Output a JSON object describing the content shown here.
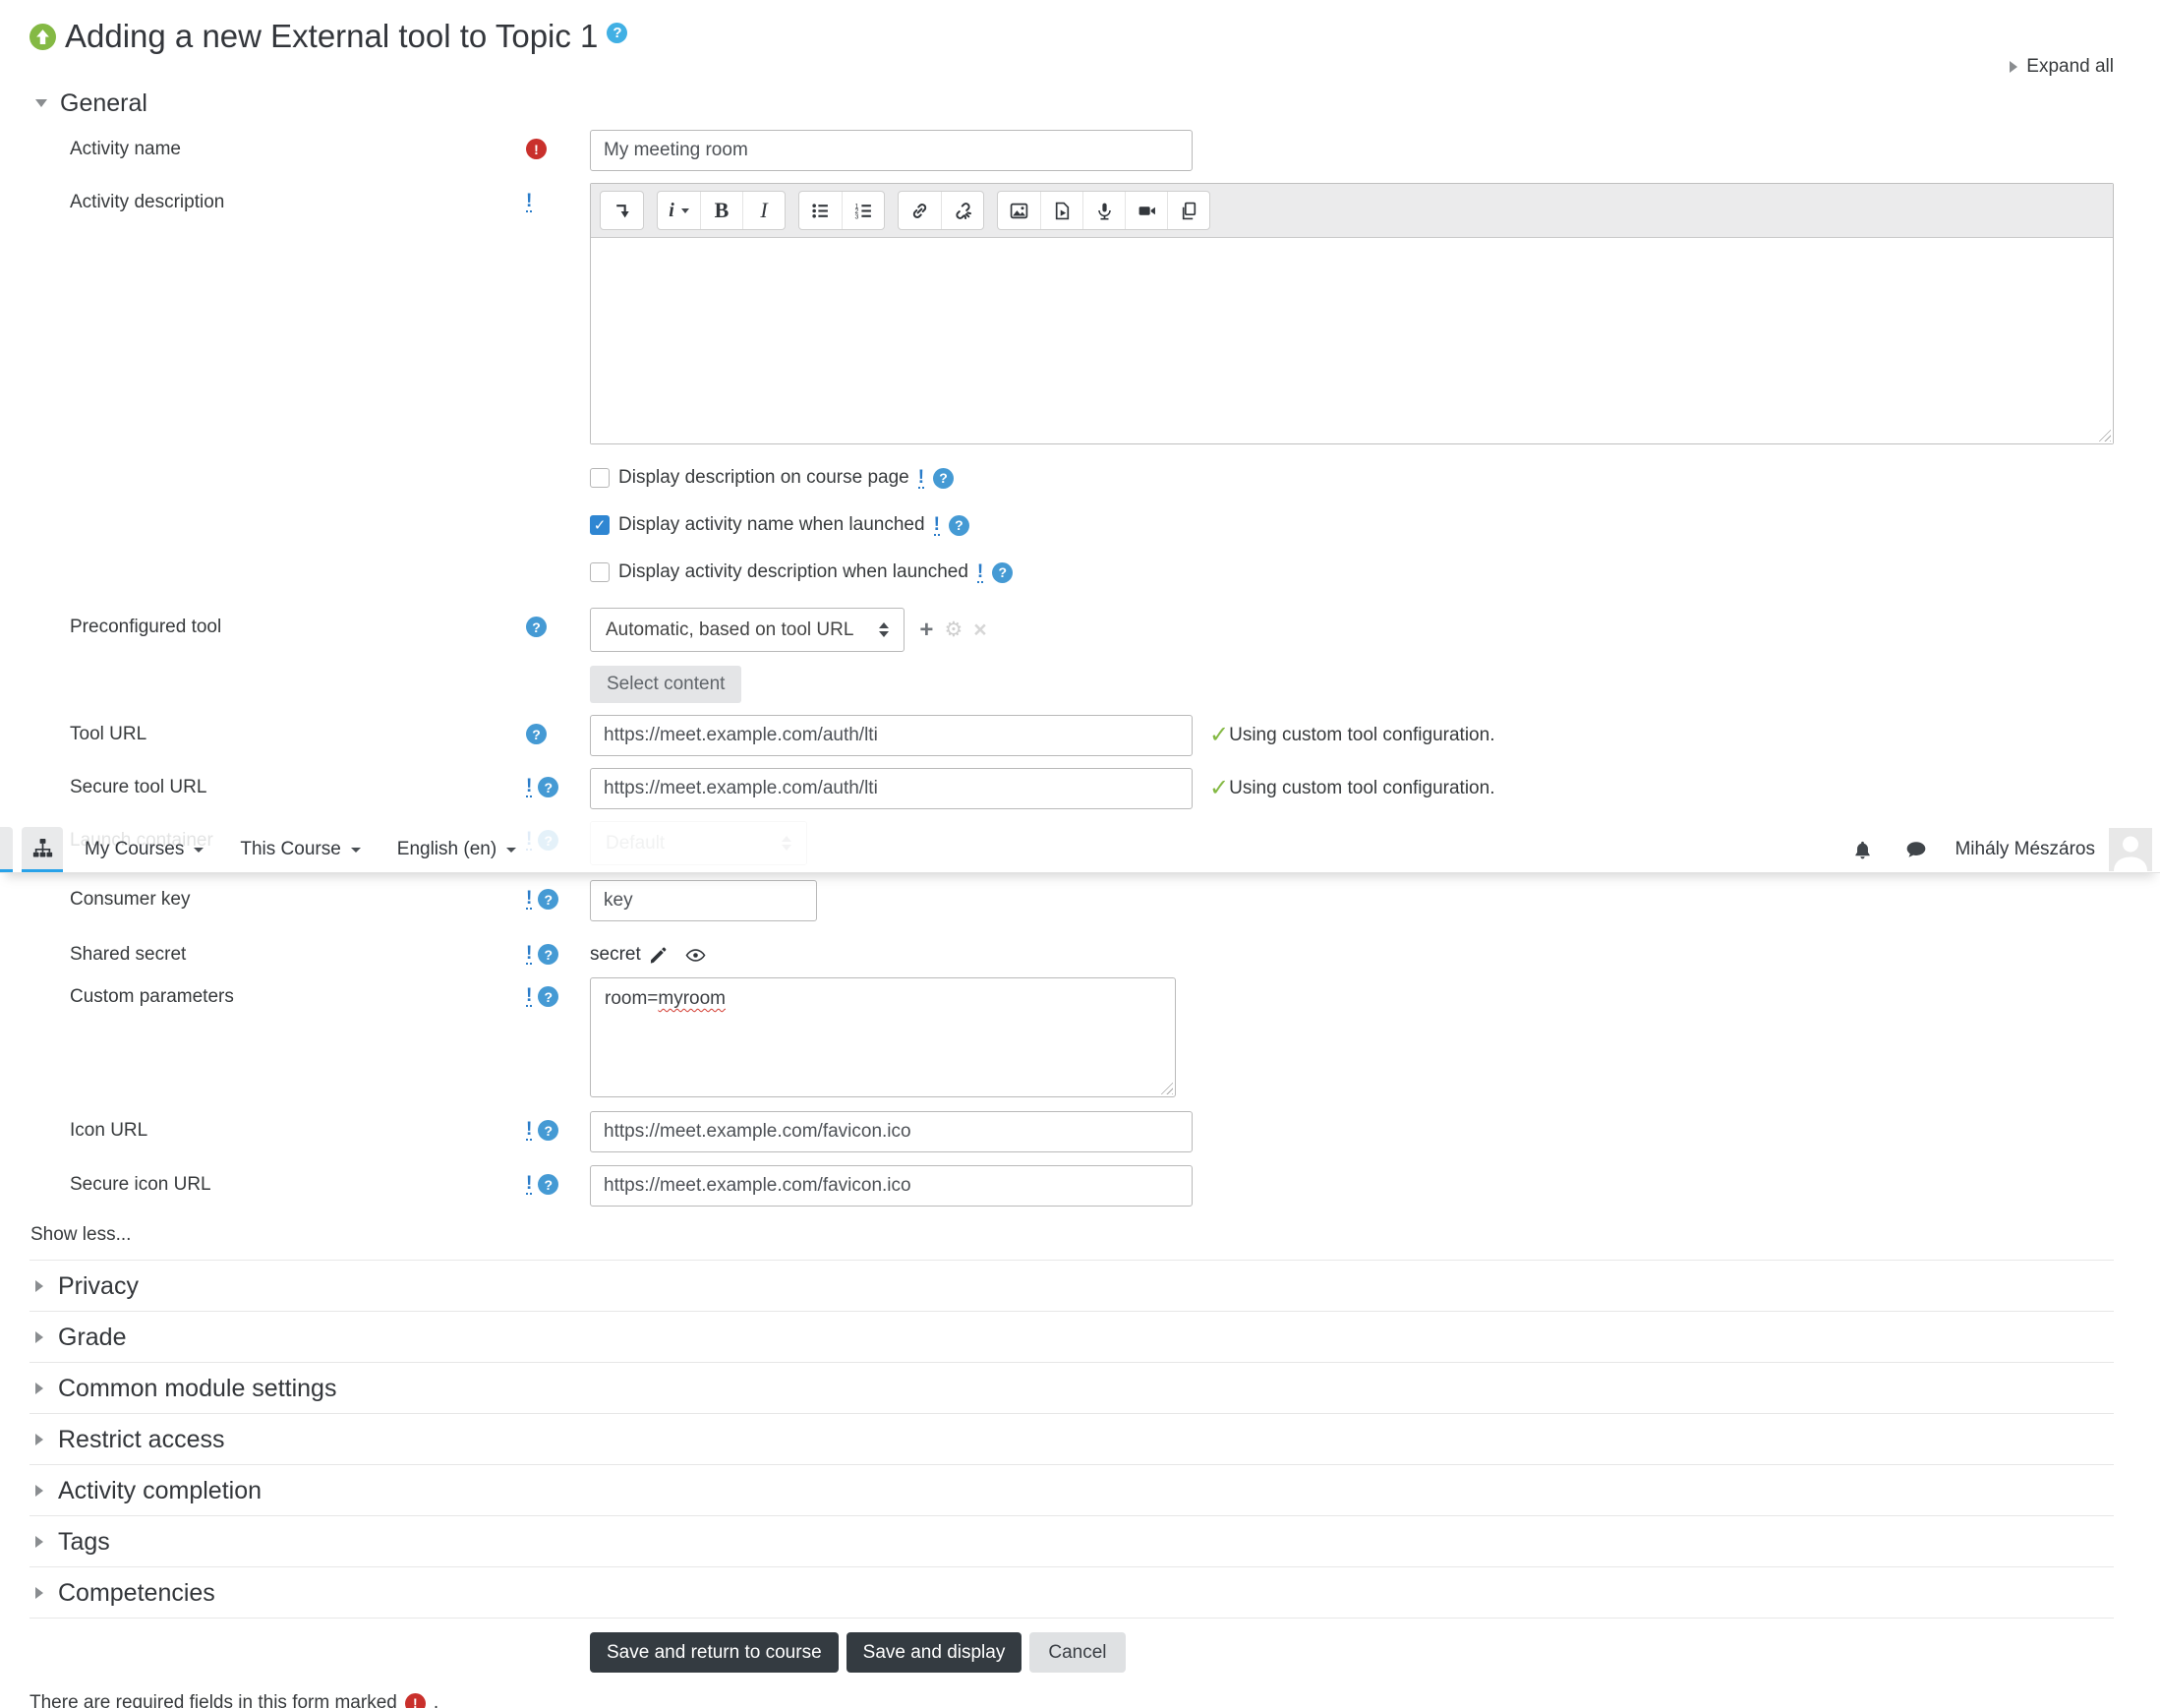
{
  "page": {
    "title": "Adding a new External tool to Topic 1",
    "expand_all": "Expand all",
    "show_less": "Show less...",
    "required_note_prefix": "There are required fields in this form marked",
    "required_note_suffix": "."
  },
  "navbar": {
    "items": [
      {
        "label": "My Courses"
      },
      {
        "label": "This Course"
      },
      {
        "label": "English (en)"
      }
    ],
    "user_name": "Mihály Mészáros"
  },
  "sections": {
    "general": "General",
    "collapsed": [
      "Privacy",
      "Grade",
      "Common module settings",
      "Restrict access",
      "Activity completion",
      "Tags",
      "Competencies"
    ]
  },
  "editor": {
    "toolbar": [
      "collapse-toolbar",
      "paragraph-styles",
      "bold",
      "italic",
      "unordered-list",
      "ordered-list",
      "link",
      "unlink",
      "insert-image",
      "insert-media",
      "record-audio",
      "record-video",
      "manage-files"
    ],
    "styles_glyph": "i",
    "bold_glyph": "B",
    "italic_glyph": "I"
  },
  "fields": {
    "activity_name": {
      "label": "Activity name",
      "value": "My meeting room",
      "required": true
    },
    "activity_description": {
      "label": "Activity description",
      "value": ""
    },
    "checkboxes": [
      {
        "label": "Display description on course page",
        "checked": false
      },
      {
        "label": "Display activity name when launched",
        "checked": true
      },
      {
        "label": "Display activity description when launched",
        "checked": false
      }
    ],
    "preconfigured_tool": {
      "label": "Preconfigured tool",
      "value": "Automatic, based on tool URL"
    },
    "select_content": "Select content",
    "tool_url": {
      "label": "Tool URL",
      "value": "https://meet.example.com/auth/lti",
      "status": "Using custom tool configuration."
    },
    "secure_tool_url": {
      "label": "Secure tool URL",
      "value": "https://meet.example.com/auth/lti",
      "status": "Using custom tool configuration."
    },
    "launch_container": {
      "label": "Launch container",
      "value": "Default"
    },
    "consumer_key": {
      "label": "Consumer key",
      "value": "key"
    },
    "shared_secret": {
      "label": "Shared secret",
      "value": "secret"
    },
    "custom_parameters": {
      "label": "Custom parameters",
      "value": "room=myroom",
      "value_prefix": "room=",
      "spellcheck_flagged": "myroom"
    },
    "icon_url": {
      "label": "Icon URL",
      "value": "https://meet.example.com/favicon.ico"
    },
    "secure_icon_url": {
      "label": "Secure icon URL",
      "value": "https://meet.example.com/favicon.ico"
    }
  },
  "buttons": {
    "save_return": "Save and return to course",
    "save_display": "Save and display",
    "cancel": "Cancel"
  },
  "colors": {
    "accent_blue": "#2f86d2",
    "help_blue": "#459ad4",
    "advanced_blue": "#2a7cc9",
    "tab_underline": "#28a2e9",
    "required_red": "#c9302c",
    "success_green": "#84b944",
    "button_dark": "#343b41"
  }
}
